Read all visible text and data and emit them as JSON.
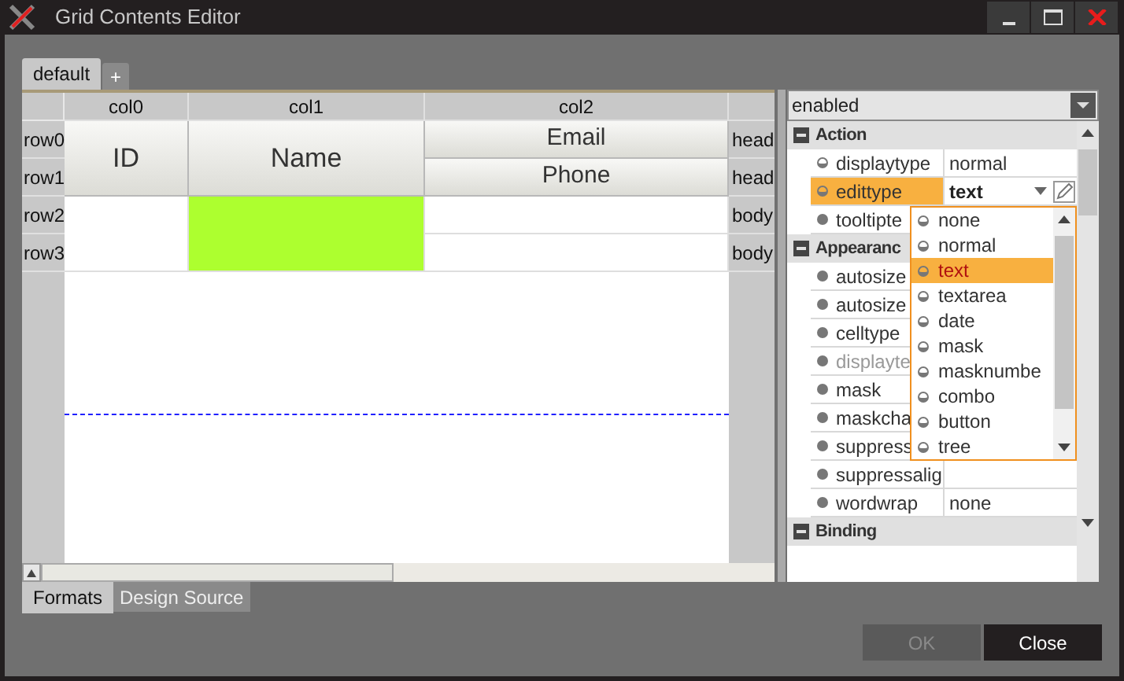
{
  "window": {
    "title": "Grid Contents Editor"
  },
  "format_tabs": [
    {
      "label": "default",
      "selected": true
    },
    {
      "label": "+",
      "selected": false
    }
  ],
  "grid": {
    "columns": [
      "col0",
      "col1",
      "col2"
    ],
    "rows": [
      {
        "label": "row0",
        "band": "head"
      },
      {
        "label": "row1",
        "band": "head"
      },
      {
        "label": "row2",
        "band": "body"
      },
      {
        "label": "row3",
        "band": "body"
      }
    ],
    "head_cells": [
      "ID",
      "Name",
      "Email",
      "Phone"
    ],
    "body_cells": [
      {
        "color": "#ffffff"
      },
      {
        "color": "#adff2f"
      },
      {
        "color": "#ffffff"
      },
      {
        "color": "#ffffff"
      }
    ]
  },
  "bottom_tabs": [
    {
      "label": "Formats",
      "selected": true
    },
    {
      "label": "Design Source",
      "selected": false
    }
  ],
  "properties": {
    "filter": "enabled",
    "items": [
      {
        "kind": "group",
        "label": "Action"
      },
      {
        "kind": "ring",
        "name": "displaytype",
        "value": "normal",
        "selected": false,
        "disabled": false
      },
      {
        "kind": "ring",
        "name": "edittype",
        "value": "text",
        "selected": true,
        "disabled": false
      },
      {
        "kind": "dot",
        "name": "tooltipte",
        "selected": false,
        "disabled": false
      },
      {
        "kind": "group",
        "label": "Appearanc"
      },
      {
        "kind": "dot",
        "name": "autosize",
        "selected": false,
        "disabled": false
      },
      {
        "kind": "dot",
        "name": "autosize",
        "selected": false,
        "disabled": false
      },
      {
        "kind": "dot",
        "name": "celltype",
        "selected": false,
        "disabled": false
      },
      {
        "kind": "dot",
        "name": "displayte",
        "selected": false,
        "disabled": true
      },
      {
        "kind": "dot",
        "name": "mask",
        "selected": false,
        "disabled": false
      },
      {
        "kind": "dot",
        "name": "maskcha",
        "selected": false,
        "disabled": false
      },
      {
        "kind": "dot",
        "name": "suppress",
        "selected": false,
        "disabled": false
      },
      {
        "kind": "dot",
        "name": "suppressalig",
        "selected": false,
        "disabled": false
      },
      {
        "kind": "dot",
        "name": "wordwrap",
        "value": "none",
        "selected": false,
        "disabled": false
      },
      {
        "kind": "group",
        "label": "Binding"
      }
    ],
    "dropdown": [
      {
        "label": "none",
        "selected": false
      },
      {
        "label": "normal",
        "selected": false
      },
      {
        "label": "text",
        "selected": true
      },
      {
        "label": "textarea",
        "selected": false
      },
      {
        "label": "date",
        "selected": false
      },
      {
        "label": "mask",
        "selected": false
      },
      {
        "label": "masknumbe",
        "selected": false
      },
      {
        "label": "combo",
        "selected": false
      },
      {
        "label": "button",
        "selected": false
      },
      {
        "label": "tree",
        "selected": false
      }
    ]
  },
  "buttons": [
    {
      "label": "OK",
      "disabled": true
    },
    {
      "label": "Close",
      "disabled": false
    }
  ]
}
